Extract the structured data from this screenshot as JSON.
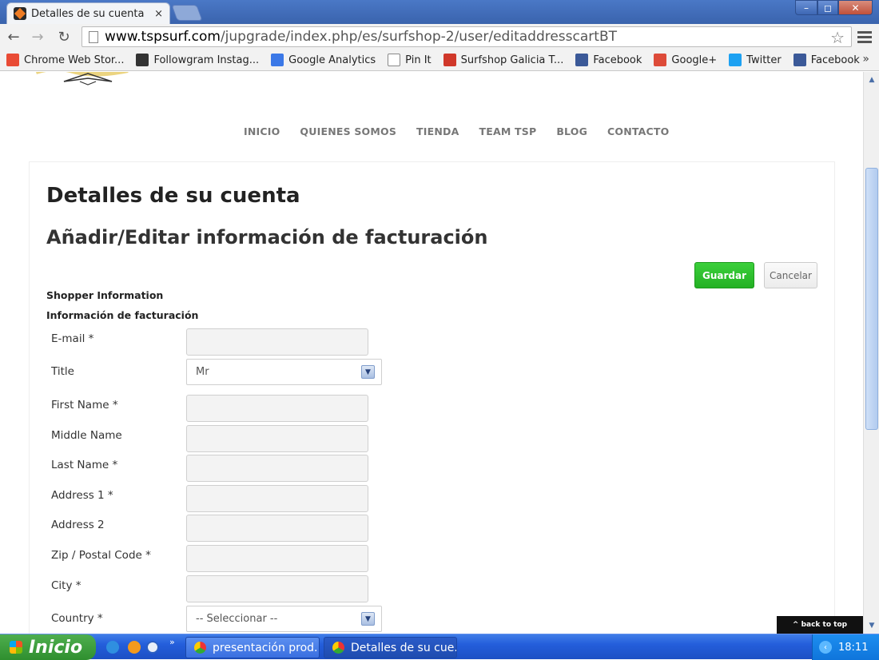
{
  "browser": {
    "tab_title": "Detalles de su cuenta",
    "tab_close": "×",
    "window_controls": {
      "minimize": "–",
      "maximize": "◻",
      "close": "✕"
    },
    "url_host": "www.tspsurf.com",
    "url_path": "/jupgrade/index.php/es/surfshop-2/user/editaddresscartBT",
    "bookmarks": [
      {
        "label": "Chrome Web Stor...",
        "icon": "chrome-web-store-icon",
        "color": "#e94b35"
      },
      {
        "label": "Followgram Instag...",
        "icon": "followgram-icon",
        "color": "#333333"
      },
      {
        "label": "Google Analytics",
        "icon": "google-analytics-icon",
        "color": "#3b78e7"
      },
      {
        "label": "Pin It",
        "icon": "page-icon",
        "color": "#ffffff"
      },
      {
        "label": "Surfshop Galicia T...",
        "icon": "surfshop-icon",
        "color": "#d0382a"
      },
      {
        "label": "Facebook",
        "icon": "facebook-icon",
        "color": "#3b5998"
      },
      {
        "label": "Google+",
        "icon": "google-plus-icon",
        "color": "#dd4b39"
      },
      {
        "label": "Twitter",
        "icon": "twitter-icon",
        "color": "#1da1f2"
      },
      {
        "label": "Facebook",
        "icon": "facebook-icon",
        "color": "#3b5998"
      }
    ],
    "bookmarks_more": "»"
  },
  "site": {
    "nav": [
      "INICIO",
      "QUIENES SOMOS",
      "TIENDA",
      "TEAM TSP",
      "BLOG",
      "CONTACTO"
    ],
    "page_title": "Detalles de su cuenta",
    "section_title": "Añadir/Editar información de facturación",
    "buttons": {
      "save": "Guardar",
      "cancel": "Cancelar"
    },
    "shopper_info": "Shopper Information",
    "billing_info": "Información de facturación",
    "form": {
      "email_label": "E-mail *",
      "title_label": "Title",
      "title_value": "Mr",
      "first_name_label": "First Name *",
      "middle_name_label": "Middle Name",
      "last_name_label": "Last Name *",
      "address1_label": "Address 1 *",
      "address2_label": "Address 2",
      "zip_label": "Zip / Postal Code *",
      "city_label": "City *",
      "country_label": "Country *",
      "country_value": "-- Seleccionar --"
    },
    "back_to_top": "^ back to top",
    "colors": {
      "save_button": "#23b123",
      "nav_text": "#777777"
    }
  },
  "taskbar": {
    "start_label": "Inicio",
    "quicklaunch_more": "»",
    "tasks": [
      "presentación prod...",
      "Detalles de su cue..."
    ],
    "clock": "18:11"
  }
}
